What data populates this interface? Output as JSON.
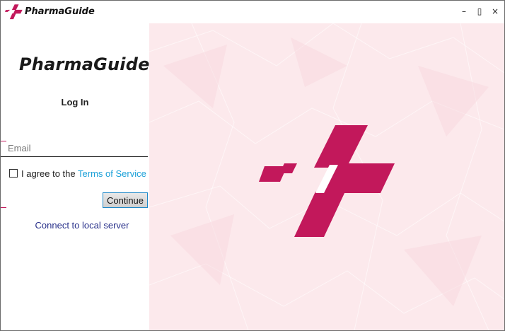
{
  "window": {
    "title": "PharmaGuide",
    "controls": {
      "minimize": "–",
      "restore": "▯",
      "close": "×"
    }
  },
  "login": {
    "brand": "PharmaGuide",
    "heading": "Log In",
    "email_placeholder": "Email",
    "email_value": "",
    "terms_prefix": "I agree to the",
    "terms_link": "Terms of Service",
    "terms_checked": false,
    "continue_label": "Continue",
    "local_server_link": "Connect to local server"
  },
  "colors": {
    "brand": "#c2185b",
    "link": "#1aa0d8",
    "local_link": "#28308a",
    "right_bg": "#fce9ec"
  },
  "icons": {
    "titlebar_logo": "pharmaguide-logo-icon",
    "hero_logo": "pharmaguide-logo-icon"
  }
}
